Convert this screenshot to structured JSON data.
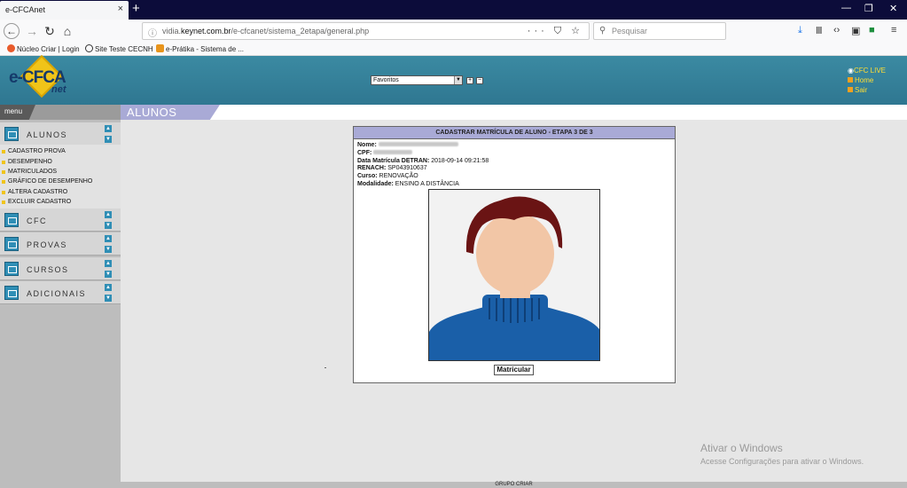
{
  "browser": {
    "tab_title": "e-CFCAnet",
    "tab_close": "×",
    "new_tab": "+",
    "url_prefix": "vidia.",
    "url_domain": "keynet.com.br",
    "url_path": "/e-cfcanet/sistema_2etapa/general.php",
    "search_placeholder": "Pesquisar",
    "url_actions": "··· ⛉ ☆",
    "bookmarks": [
      "Núcleo Criar | Login",
      "Site Teste CECNH",
      "e-Prátika - Sistema de ..."
    ]
  },
  "header": {
    "logo_main": "e-CFCA",
    "logo_sub": "net",
    "favorites_label": "Favoritos",
    "links": [
      "CFC LIVE",
      "Home",
      "Sair"
    ]
  },
  "menu": {
    "title": "menu",
    "sections": [
      "ALUNOS",
      "CFC",
      "PROVAS",
      "CURSOS",
      "ADICIONAIS"
    ],
    "alunos_items": [
      "CADASTRO PROVA",
      "DESEMPENHO",
      "MATRICULADOS",
      "GRÁFICO DE DESEMPENHO",
      "ALTERA CADASTRO",
      "EXCLUIR CADASTRO"
    ]
  },
  "page": {
    "section_title": "ALUNOS",
    "panel_title": "CADASTRAR MATRÍCULA DE ALUNO - ETAPA 3 DE 3",
    "nome_label": "Nome:",
    "cpf_label": "CPF:",
    "data_label": "Data Matrícula DETRAN:",
    "data_value": "2018-09-14 09:21:58",
    "renach_label": "RENACH:",
    "renach_value": "SP043910637",
    "curso_label": "Curso:",
    "curso_value": "RENOVAÇÃO",
    "modalidade_label": "Modalidade:",
    "modalidade_value": "ENSINO A DISTÂNCIA",
    "submit_label": "Matricular"
  },
  "footer": {
    "text": "GRUPO CRIAR"
  },
  "watermark": {
    "line1": "Ativar o Windows",
    "line2": "Acesse Configurações para ativar o Windows."
  },
  "colors": {
    "header_teal": "#3b8aa2",
    "panel_header": "#a9aad6",
    "logo_yellow": "#f0c419"
  }
}
